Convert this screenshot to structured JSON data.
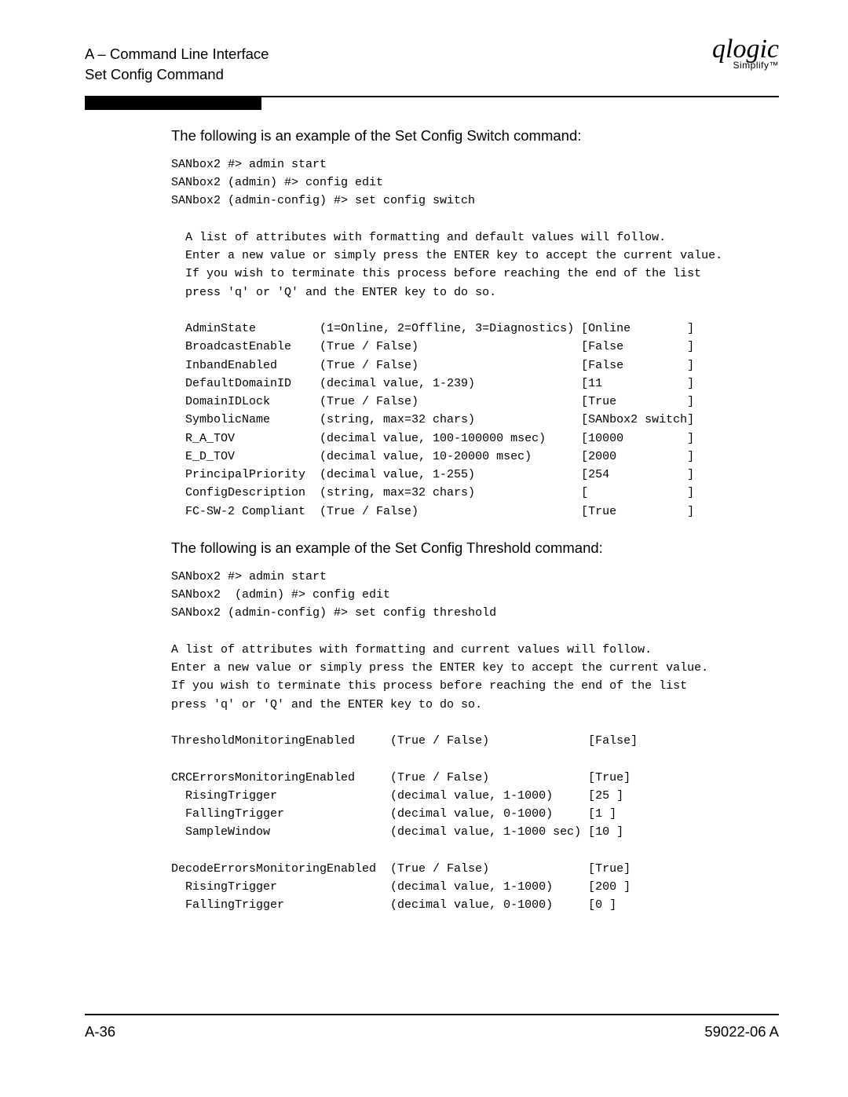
{
  "header": {
    "section": "A – Command Line Interface",
    "subtitle": "Set Config Command"
  },
  "logo": {
    "main": "qlogic",
    "sub": "Simplify™"
  },
  "section1": {
    "intro": "The following is an example of the Set Config Switch command:",
    "pre": "SANbox2 #> admin start\nSANbox2 (admin) #> config edit\nSANbox2 (admin-config) #> set config switch\n\n  A list of attributes with formatting and default values will follow.\n  Enter a new value or simply press the ENTER key to accept the current value.\n  If you wish to terminate this process before reaching the end of the list\n  press 'q' or 'Q' and the ENTER key to do so.\n\n  AdminState         (1=Online, 2=Offline, 3=Diagnostics) [Online        ]\n  BroadcastEnable    (True / False)                       [False         ]\n  InbandEnabled      (True / False)                       [False         ]\n  DefaultDomainID    (decimal value, 1-239)               [11            ]\n  DomainIDLock       (True / False)                       [True          ]\n  SymbolicName       (string, max=32 chars)               [SANbox2 switch]\n  R_A_TOV            (decimal value, 100-100000 msec)     [10000         ]\n  E_D_TOV            (decimal value, 10-20000 msec)       [2000          ]\n  PrincipalPriority  (decimal value, 1-255)               [254           ]\n  ConfigDescription  (string, max=32 chars)               [              ]\n  FC-SW-2 Compliant  (True / False)                       [True          ]"
  },
  "section2": {
    "intro": "The following is an example of the Set Config Threshold command:",
    "pre": "SANbox2 #> admin start\nSANbox2  (admin) #> config edit\nSANbox2 (admin-config) #> set config threshold\n\nA list of attributes with formatting and current values will follow.\nEnter a new value or simply press the ENTER key to accept the current value.\nIf you wish to terminate this process before reaching the end of the list\npress 'q' or 'Q' and the ENTER key to do so.\n\nThresholdMonitoringEnabled     (True / False)              [False]\n\nCRCErrorsMonitoringEnabled     (True / False)              [True]\n  RisingTrigger                (decimal value, 1-1000)     [25 ]\n  FallingTrigger               (decimal value, 0-1000)     [1 ]\n  SampleWindow                 (decimal value, 1-1000 sec) [10 ]\n\nDecodeErrorsMonitoringEnabled  (True / False)              [True]\n  RisingTrigger                (decimal value, 1-1000)     [200 ]\n  FallingTrigger               (decimal value, 0-1000)     [0 ]"
  },
  "footer": {
    "left": "A-36",
    "right": "59022-06 A"
  }
}
